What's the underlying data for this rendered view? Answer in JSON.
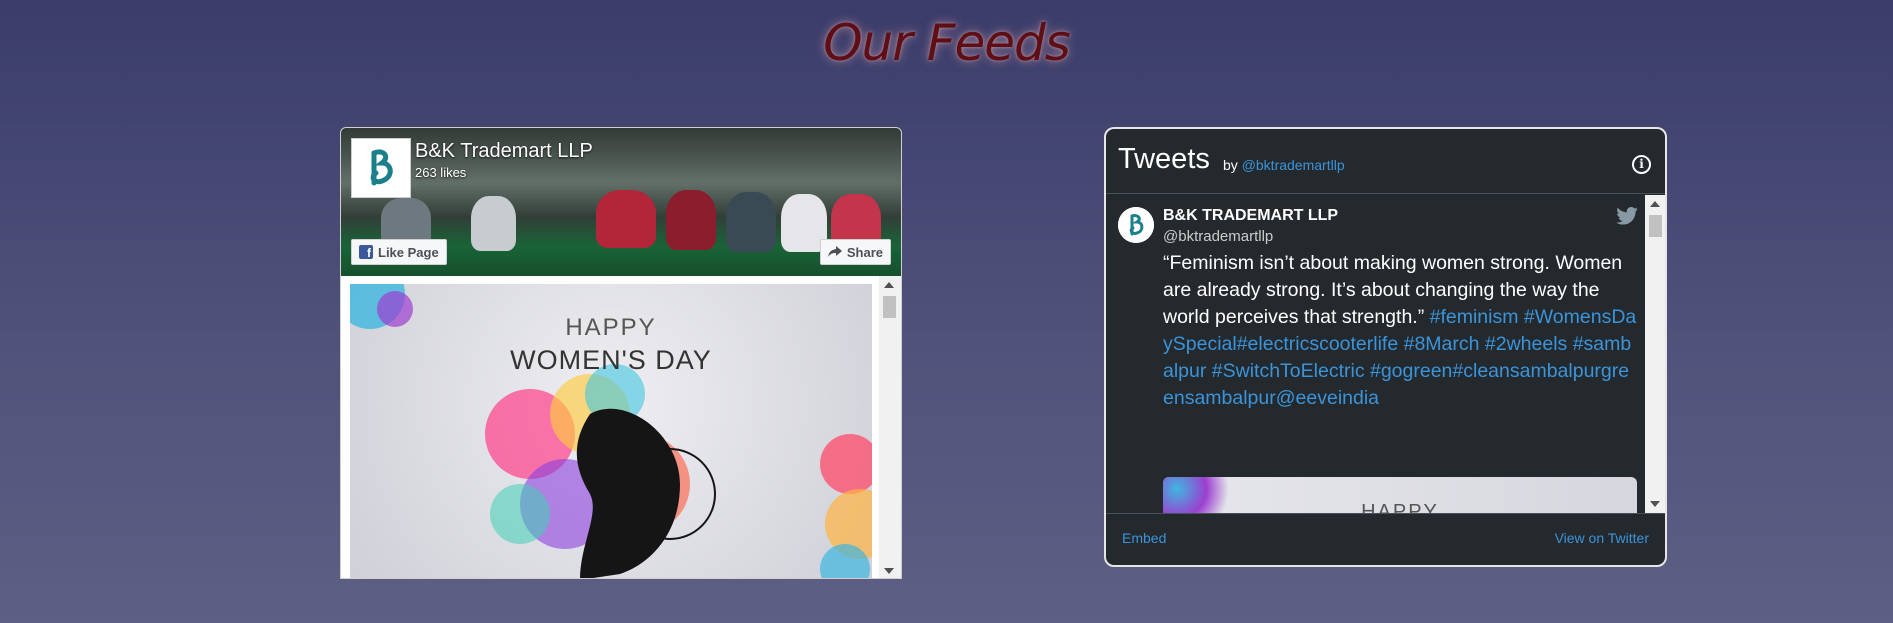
{
  "page": {
    "title": "Our Feeds"
  },
  "facebook": {
    "page_name": "B&K Trademart LLP",
    "likes": "263 likes",
    "like_button": "Like Page",
    "share_button": "Share",
    "post_image_text_1": "HAPPY",
    "post_image_text_2": "WOMEN'S DAY",
    "logo_icon": "bk-logo-icon",
    "colors": {
      "facebook_blue": "#3b5998"
    }
  },
  "twitter": {
    "title": "Tweets",
    "by_label": "by",
    "by_handle": "@bktrademartllp",
    "tweet": {
      "author": "B&K TRADEMART LLP",
      "handle": "@bktrademartllp",
      "text": "“Feminism isn’t about making women strong. Women are already strong. It’s about changing the way the world perceives that strength.”",
      "hashtags": "#feminism #WomensDaySpecial#electricscooterlife #8March #2wheels #sambalpur #SwitchToElectric #gogreen#cleansambalpurgreensambalpur@eeveindia",
      "media_text": "HAPPY"
    },
    "footer": {
      "embed": "Embed",
      "view_on_twitter": "View on Twitter"
    },
    "colors": {
      "link": "#3b94d9",
      "background": "#24292e"
    }
  }
}
